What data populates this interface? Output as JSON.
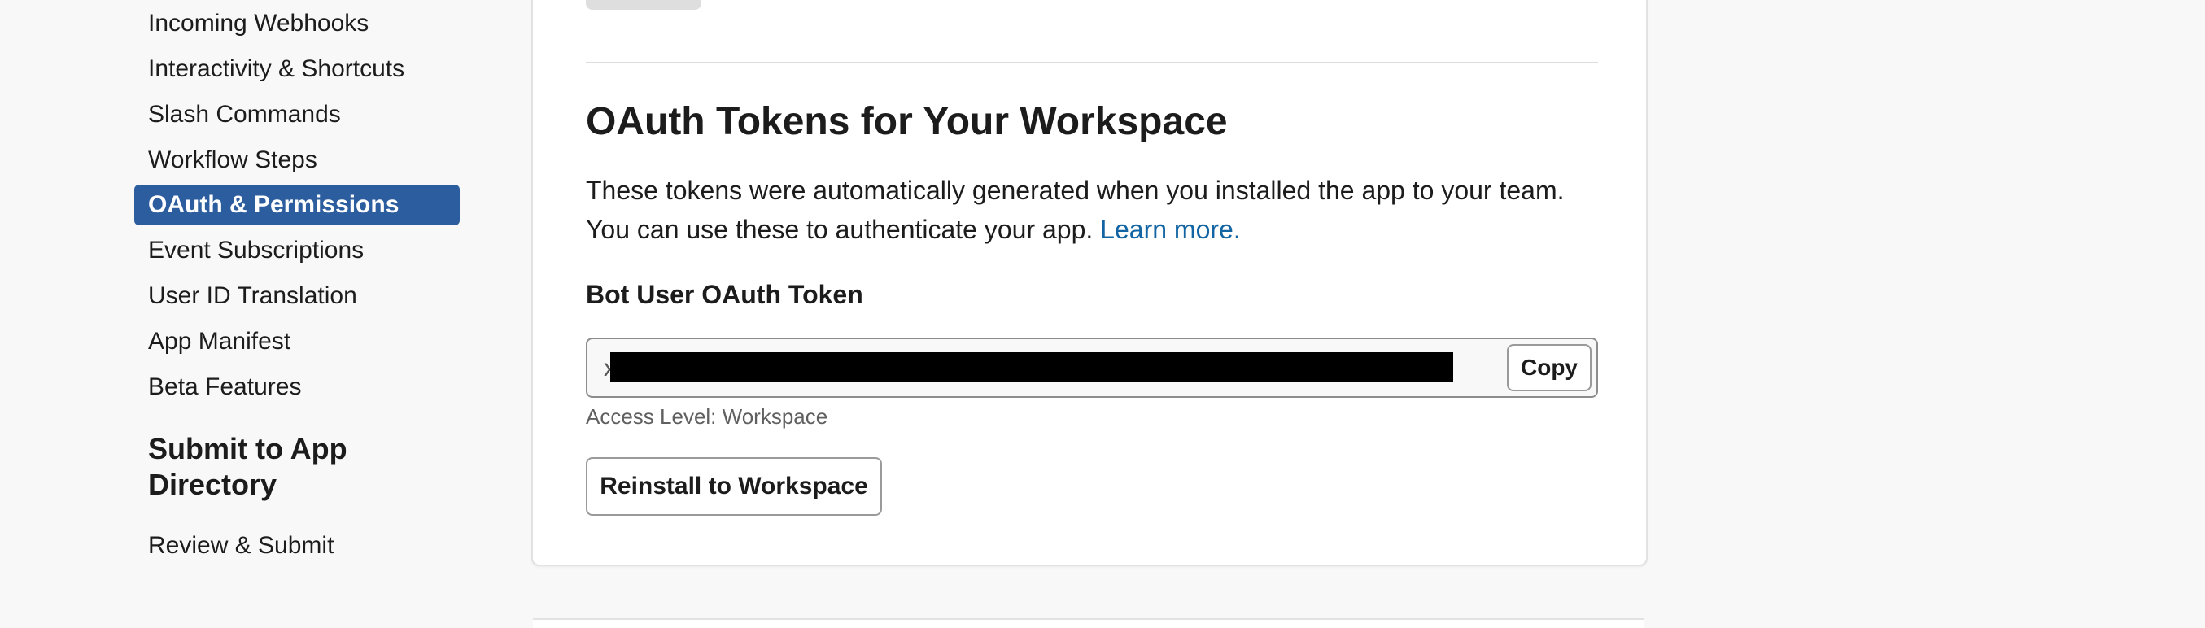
{
  "sidebar": {
    "items": [
      {
        "label": "Incoming Webhooks",
        "active": false
      },
      {
        "label": "Interactivity & Shortcuts",
        "active": false
      },
      {
        "label": "Slash Commands",
        "active": false
      },
      {
        "label": "Workflow Steps",
        "active": false
      },
      {
        "label": "OAuth & Permissions",
        "active": true
      },
      {
        "label": "Event Subscriptions",
        "active": false
      },
      {
        "label": "User ID Translation",
        "active": false
      },
      {
        "label": "App Manifest",
        "active": false
      },
      {
        "label": "Beta Features",
        "active": false
      }
    ],
    "section_heading": "Submit to App Directory",
    "section_items": [
      {
        "label": "Review & Submit"
      }
    ]
  },
  "card": {
    "title": "OAuth Tokens for Your Workspace",
    "description": "These tokens were automatically generated when you installed the app to your team. You can use these to authenticate your app.",
    "learn_more": "Learn more.",
    "token_label": "Bot User OAuth Token",
    "token_value_prefix": "x",
    "copy_label": "Copy",
    "access_level": "Access Level: Workspace",
    "reinstall_label": "Reinstall to Workspace"
  },
  "colors": {
    "active_bg": "#2c5d9e",
    "link": "#1264a3",
    "page_bg": "#f8f8f8"
  }
}
